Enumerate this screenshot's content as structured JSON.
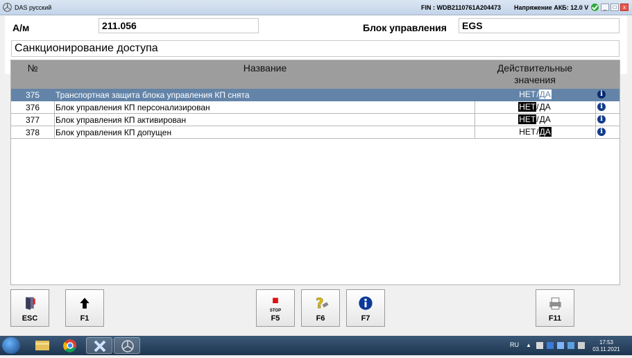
{
  "window": {
    "title": "DAS русский",
    "fin": "FIN : WDB2110761A204473",
    "voltage": "Напряжение АКБ: 12.0 V",
    "controls": [
      "_",
      "□",
      "x"
    ]
  },
  "header": {
    "model_label": "А/м",
    "model_value": "211.056",
    "ecu_label": "Блок управления",
    "ecu_value": "EGS",
    "section_title": "Санкционирование доступа"
  },
  "table": {
    "col_num": "№",
    "col_name": "Название",
    "col_values_line1": "Действительные",
    "col_values_line2": "значения",
    "rows": [
      {
        "num": "375",
        "name": "Транспортная защита блока управления КП снята",
        "no": "НЕТ",
        "sep": "/",
        "yes": "ДА",
        "active": "yes"
      },
      {
        "num": "376",
        "name": "Блок управления КП персонализирован",
        "no": "НЕТ",
        "sep": "/",
        "yes": "ДА",
        "active": "no"
      },
      {
        "num": "377",
        "name": "Блок управления КП активирован",
        "no": "НЕТ",
        "sep": "/",
        "yes": "ДА",
        "active": "no"
      },
      {
        "num": "378",
        "name": "Блок управления КП допущен",
        "no": "НЕТ",
        "sep": "/",
        "yes": "ДА",
        "active": "yes"
      }
    ]
  },
  "toolbar": {
    "esc": "ESC",
    "f1": "F1",
    "f5_stop": "STOP",
    "f5": "F5",
    "f6": "F6",
    "f7": "F7",
    "f11": "F11"
  },
  "taskbar": {
    "lang": "RU",
    "time": "17:53",
    "date": "03.11.2021"
  },
  "colors": {
    "selected_row": "#6384a8",
    "header_gray": "#9d9d9d",
    "info_blue": "#143c8c"
  }
}
